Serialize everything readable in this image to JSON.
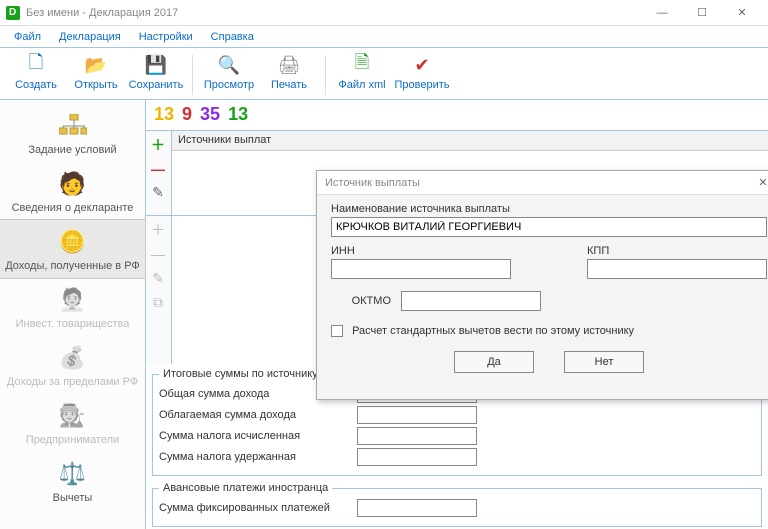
{
  "window": {
    "title": "Без имени - Декларация 2017"
  },
  "menu": {
    "file": "Файл",
    "declaration": "Декларация",
    "settings": "Настройки",
    "help": "Справка"
  },
  "toolbar": {
    "create": "Создать",
    "open": "Открыть",
    "save": "Сохранить",
    "preview": "Просмотр",
    "print": "Печать",
    "xml": "Файл xml",
    "check": "Проверить"
  },
  "sidebar": {
    "conditions": "Задание условий",
    "declarant": "Сведения о декларанте",
    "income_rf": "Доходы, полученные в РФ",
    "invest": "Инвест. товарищества",
    "income_abroad": "Доходы за пределами РФ",
    "entrepreneurs": "Предприниматели",
    "deductions": "Вычеты"
  },
  "combo": {
    "n1": "13",
    "n2": "9",
    "n3": "35",
    "n4": "13"
  },
  "sources": {
    "header": "Источники выплат"
  },
  "totals": {
    "legend": "Итоговые суммы по источнику выплат",
    "total_income": "Общая сумма дохода",
    "taxable_income": "Облагаемая сумма дохода",
    "tax_calculated": "Сумма налога исчисленная",
    "tax_withheld": "Сумма налога удержанная"
  },
  "advance": {
    "legend": "Авансовые платежи иностранца",
    "fixed": "Сумма фиксированных платежей"
  },
  "modal": {
    "title": "Источник выплаты",
    "name_label": "Наименование источника выплаты",
    "name_value": "КРЮЧКОВ ВИТАЛИЙ ГЕОРГИЕВИЧ",
    "inn_label": "ИНН",
    "kpp_label": "КПП",
    "oktmo_label": "ОКТМО",
    "checkbox": "Расчет стандартных вычетов вести по этому источнику",
    "yes": "Да",
    "no": "Нет",
    "inn_value": "",
    "kpp_value": "",
    "oktmo_value": ""
  }
}
